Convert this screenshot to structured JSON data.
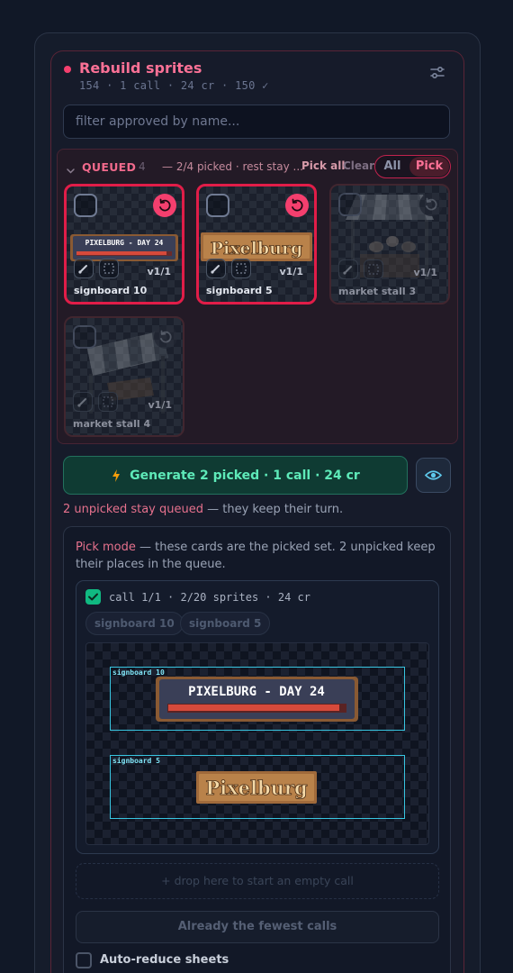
{
  "header": {
    "title": "Rebuild sprites",
    "subtitle": "154 · 1 call · 24 cr · 150 ✓",
    "settings_icon": "sliders-icon",
    "accent": "#f43f6e"
  },
  "filter": {
    "placeholder": "filter approved by name...",
    "value": ""
  },
  "queue": {
    "label": "QUEUED",
    "count": "4",
    "info": "— 2/4 picked · rest stay ...",
    "pick_all": "Pick all",
    "clear": "Clear",
    "toggle": {
      "all": "All",
      "pick": "Pick",
      "selected": "Pick"
    },
    "cards": [
      {
        "name": "signboard 10",
        "version": "v1/1",
        "picked": true,
        "art_text": "PIXELBURG - DAY 24"
      },
      {
        "name": "signboard 5",
        "version": "v1/1",
        "picked": true,
        "art_text": "Pixelburg"
      },
      {
        "name": "market stall 3",
        "version": "v1/1",
        "picked": false
      },
      {
        "name": "market stall 4",
        "version": "v1/1",
        "picked": false
      }
    ]
  },
  "generate": {
    "label": "Generate 2 picked · 1 call · 24 cr",
    "color": "#5eeab9"
  },
  "hint": {
    "highlight": "2 unpicked stay queued",
    "rest": " — they keep their turn."
  },
  "pick_mode": {
    "highlight": "Pick mode",
    "text": " — these cards are the picked set. 2 unpicked keep their places in the queue.",
    "call": {
      "checked": true,
      "label": "call 1/1 · 2/20 sprites · 24 cr",
      "chips": [
        "signboard 10",
        "signboard 5"
      ],
      "sheet_slots": [
        {
          "label": "signboard 10",
          "art_text": "PIXELBURG - DAY 24"
        },
        {
          "label": "signboard 5",
          "art_text": "Pixelburg"
        }
      ]
    },
    "dropzone": "+ drop here to start an empty call",
    "fewest_button": "Already the fewest calls",
    "auto_reduce": {
      "label": "Auto-reduce sheets",
      "checked": false
    }
  }
}
